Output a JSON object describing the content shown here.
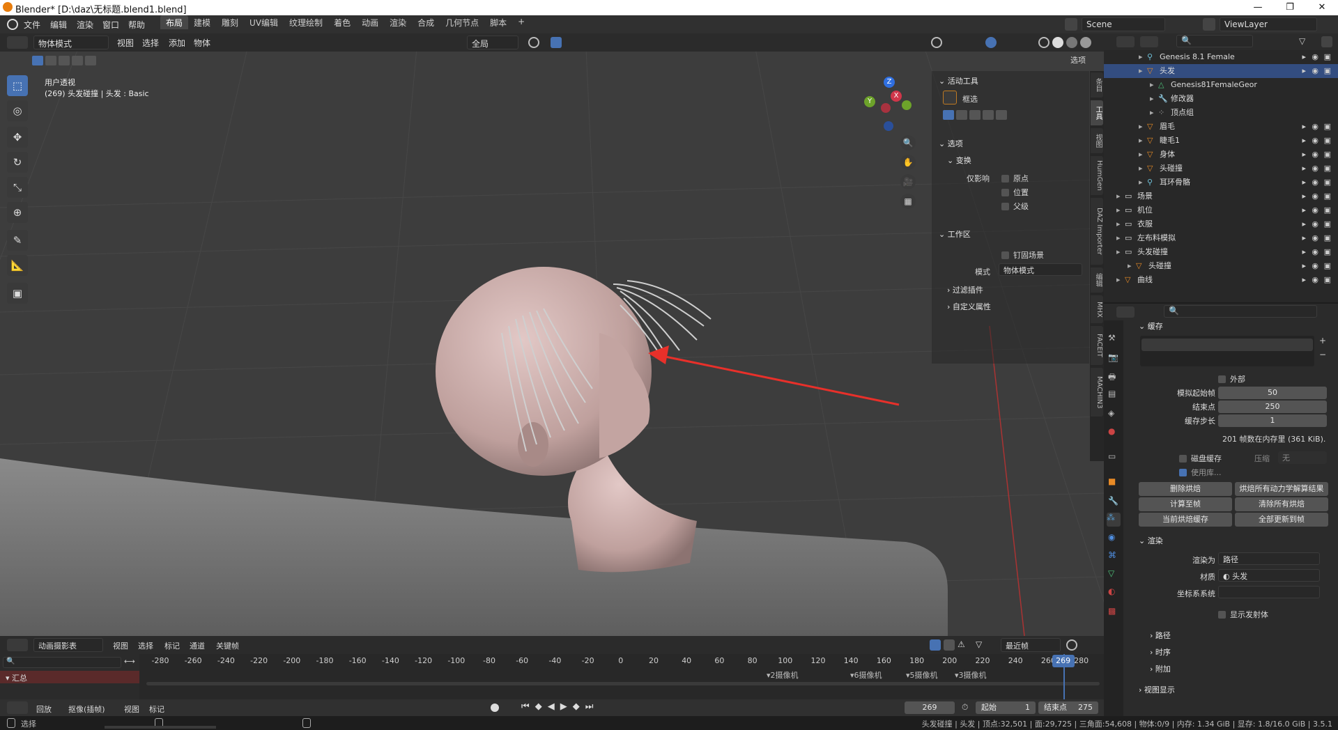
{
  "window": {
    "title": "Blender* [D:\\daz\\无标题.blend1.blend]",
    "buttons": [
      "—",
      "❐",
      "✕"
    ]
  },
  "menubar": {
    "menus": [
      "文件",
      "编辑",
      "渲染",
      "窗口",
      "帮助"
    ],
    "workspaces": [
      "布局",
      "建模",
      "雕刻",
      "UV编辑",
      "纹理绘制",
      "着色",
      "动画",
      "渲染",
      "合成",
      "几何节点",
      "脚本"
    ],
    "active_workspace": "布局",
    "add_tab": "+",
    "scene": "Scene",
    "view_layer": "ViewLayer"
  },
  "viewport_header": {
    "mode": "物体模式",
    "menus": [
      "视图",
      "选择",
      "添加",
      "物体"
    ],
    "orientation": "全局",
    "options": "选项"
  },
  "viewport": {
    "view_name": "用户透视",
    "view_info": "(269) 头发碰撞 | 头发 : Basic",
    "gizmo": {
      "z": "Z",
      "y": "Y",
      "x": "X"
    }
  },
  "npanel": {
    "active_tool_title": "活动工具",
    "tool_name": "框选",
    "options_title": "选项",
    "transform_title": "变换",
    "affect_only_label": "仅影响",
    "affect_items": [
      "原点",
      "位置",
      "父级"
    ],
    "workspace_title": "工作区",
    "pin_scene": "钉固场景",
    "mode_label": "模式",
    "mode_value": "物体模式",
    "filter_addons": "过滤插件",
    "custom_props": "自定义属性",
    "tabs": [
      "条目",
      "工具",
      "视图",
      "HumGen",
      "DAZ Importer",
      "编辑",
      "MHX",
      "FACEIT",
      "MACHIN3"
    ]
  },
  "outliner": {
    "items": [
      {
        "name": "Genesis 8.1 Female",
        "indent": 3,
        "icon": "armature-icon",
        "selected": false
      },
      {
        "name": "头发",
        "indent": 3,
        "icon": "mesh-icon",
        "selected": true
      },
      {
        "name": "Genesis81FemaleGeor",
        "indent": 4,
        "icon": "mesh-data-icon",
        "selected": false
      },
      {
        "name": "修改器",
        "indent": 4,
        "icon": "wrench-icon",
        "selected": false
      },
      {
        "name": "顶点组",
        "indent": 4,
        "icon": "vertex-group-icon",
        "selected": false
      },
      {
        "name": "眉毛",
        "indent": 3,
        "icon": "mesh-icon",
        "selected": false
      },
      {
        "name": "睫毛1",
        "indent": 3,
        "icon": "mesh-icon",
        "selected": false
      },
      {
        "name": "身体",
        "indent": 3,
        "icon": "mesh-icon",
        "selected": false
      },
      {
        "name": "头碰撞",
        "indent": 3,
        "icon": "mesh-icon",
        "selected": false
      },
      {
        "name": "耳环骨骼",
        "indent": 3,
        "icon": "armature-icon",
        "selected": false
      },
      {
        "name": "场景",
        "indent": 1,
        "icon": "collection-icon",
        "selected": false
      },
      {
        "name": "机位",
        "indent": 1,
        "icon": "collection-icon",
        "selected": false
      },
      {
        "name": "衣服",
        "indent": 1,
        "icon": "collection-icon",
        "selected": false
      },
      {
        "name": "左布料模拟",
        "indent": 1,
        "icon": "collection-icon",
        "selected": false
      },
      {
        "name": "头发碰撞",
        "indent": 1,
        "icon": "collection-icon",
        "selected": false
      },
      {
        "name": "头碰撞",
        "indent": 2,
        "icon": "mesh-icon",
        "selected": false
      },
      {
        "name": "曲线",
        "indent": 1,
        "icon": "mesh-icon",
        "selected": false
      }
    ]
  },
  "properties": {
    "cache_title": "缓存",
    "external": "外部",
    "sim_start_label": "模拟起始帧",
    "sim_start": "50",
    "end_label": "结束点",
    "end": "250",
    "step_label": "缓存步长",
    "step": "1",
    "memory_info": "201 帧数在内存里 (361 KiB).",
    "disk_cache": "磁盘缓存",
    "compress_label": "压缩",
    "compress_value": "无",
    "use_lib": "使用库...",
    "buttons": [
      "删除烘焙",
      "烘焙所有动力学解算结果",
      "计算至帧",
      "清除所有烘焙",
      "当前烘焙缓存",
      "全部更新到帧"
    ],
    "render_title": "渲染",
    "render_as_label": "渲染为",
    "render_as": "路径",
    "material_label": "材质",
    "material": "头发",
    "coord_label": "坐标系系统",
    "show_emitter": "显示发射体",
    "sub_sections": [
      "路径",
      "时序",
      "附加",
      "视图显示"
    ]
  },
  "timeline": {
    "editor": "动画摄影表",
    "menus": [
      "视图",
      "选择",
      "标记",
      "通道",
      "关键帧"
    ],
    "snap": "最近帧",
    "summary": "汇总",
    "ticks": [
      "-280",
      "-260",
      "-240",
      "-220",
      "-200",
      "-180",
      "-160",
      "-140",
      "-120",
      "-100",
      "-80",
      "-60",
      "-40",
      "-20",
      "0",
      "20",
      "40",
      "60",
      "80",
      "100",
      "120",
      "140",
      "160",
      "180",
      "200",
      "220",
      "240",
      "260",
      "280"
    ],
    "current_frame": "269",
    "markers": [
      "2摄像机",
      "6摄像机",
      "5摄像机",
      "3摄像机"
    ]
  },
  "playbar": {
    "playback": "回放",
    "keying": "抠像(插帧)",
    "menus": [
      "视图",
      "标记"
    ],
    "frame": "269",
    "start_label": "起始",
    "start": "1",
    "end_label": "结束点",
    "end": "275"
  },
  "statusbar": {
    "left": "选择",
    "right": "头发碰撞 | 头发 | 顶点:32,501 | 面:29,725 | 三角面:54,608 | 物体:0/9 | 内存: 1.34 GiB | 显存: 1.8/16.0 GiB | 3.5.1"
  },
  "colors": {
    "accent": "#4772b3",
    "arrow": "#e8302a",
    "skin": "#c9a9a6",
    "hair": "#b9b9b9"
  }
}
